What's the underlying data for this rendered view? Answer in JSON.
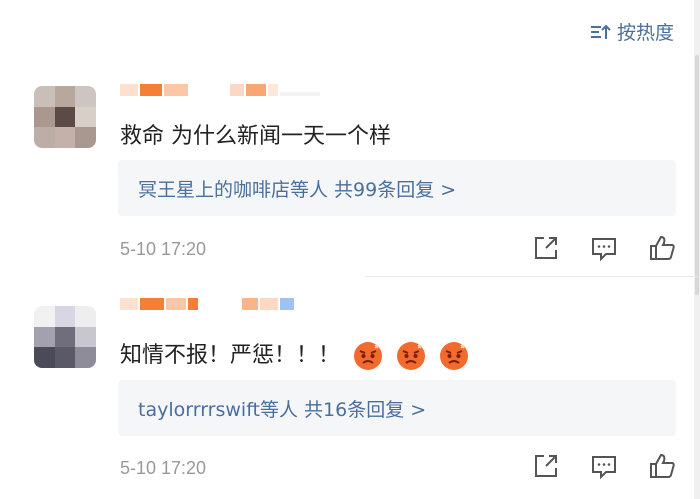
{
  "sort": {
    "label": "按热度",
    "icon": "sort-hot-icon",
    "color": "#4a6f9b"
  },
  "comments": [
    {
      "text": "救命 为什么新闻一天一个样",
      "reply_summary": "冥王星上的咖啡店等人 共99条回复 >",
      "time": "5-10 17:20",
      "actions": [
        "share-icon",
        "comment-icon",
        "like-icon"
      ]
    },
    {
      "text": "知情不报！严惩！！！",
      "emojis": [
        "angry-face-icon",
        "angry-face-icon",
        "angry-face-icon"
      ],
      "reply_summary": "taylorrrrswift等人 共16条回复 >",
      "time": "5-10 17:20",
      "actions": [
        "share-icon",
        "comment-icon",
        "like-icon"
      ]
    }
  ],
  "colors": {
    "link": "#4a6f9b",
    "muted": "#999999",
    "reply_bg": "#f5f6f8"
  }
}
